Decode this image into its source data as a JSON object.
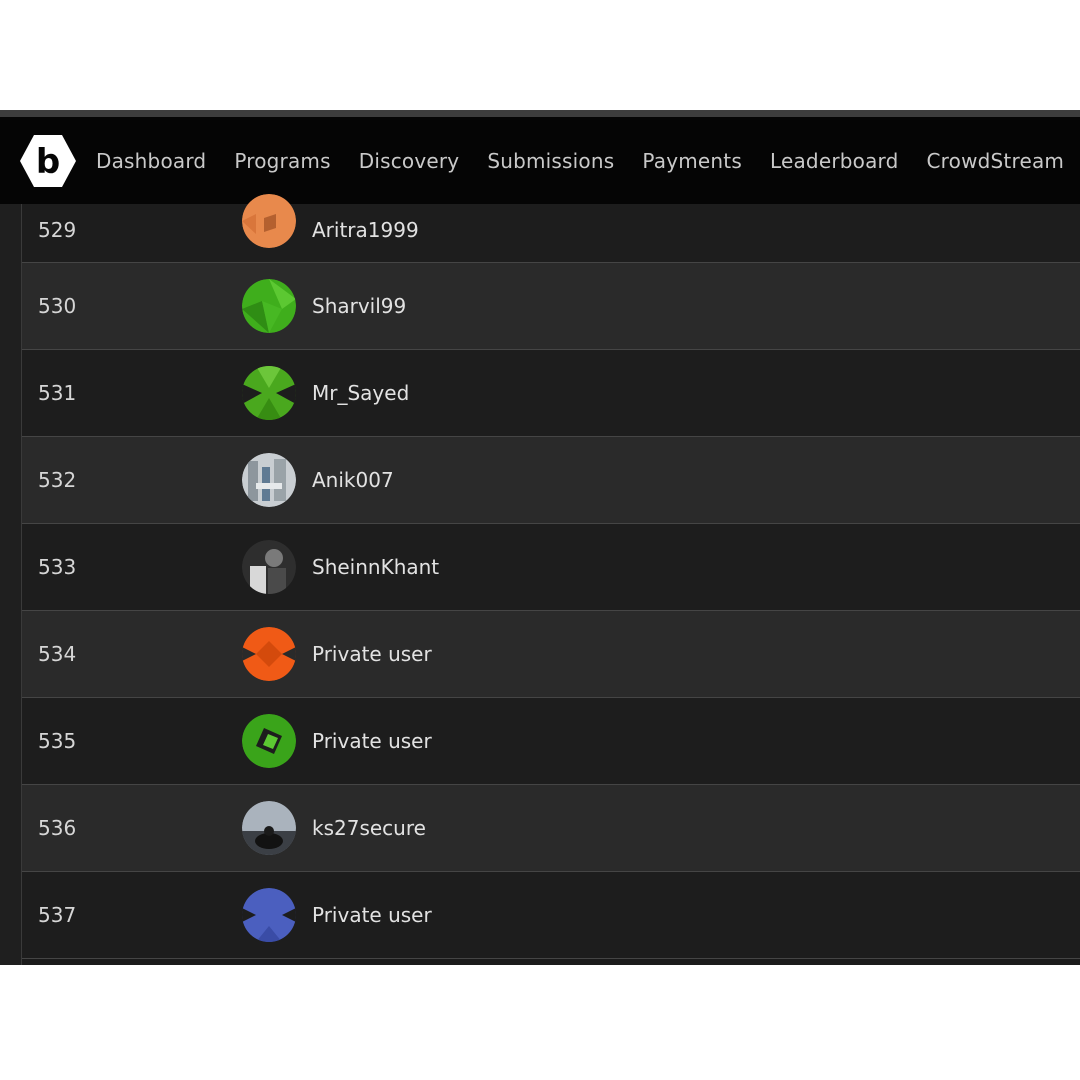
{
  "nav": {
    "items": [
      "Dashboard",
      "Programs",
      "Discovery",
      "Submissions",
      "Payments",
      "Leaderboard",
      "CrowdStream"
    ],
    "logo_letter": "b"
  },
  "leaderboard": {
    "rows": [
      {
        "rank": "529",
        "username": "Aritra1999",
        "avatar_icon": "orange-geometric-avatar",
        "avatar_color": "#e8894c"
      },
      {
        "rank": "530",
        "username": "Sharvil99",
        "avatar_icon": "green-geometric-avatar",
        "avatar_color": "#3fae1c"
      },
      {
        "rank": "531",
        "username": "Mr_Sayed",
        "avatar_icon": "green-geometric-avatar",
        "avatar_color": "#4aa81e"
      },
      {
        "rank": "532",
        "username": "Anik007",
        "avatar_icon": "photo-avatar",
        "avatar_color": "#9aa3a8"
      },
      {
        "rank": "533",
        "username": "SheinnKhant",
        "avatar_icon": "photo-avatar",
        "avatar_color": "#5a5a5a"
      },
      {
        "rank": "534",
        "username": "Private user",
        "avatar_icon": "orange-geometric-avatar",
        "avatar_color": "#f05a16"
      },
      {
        "rank": "535",
        "username": "Private user",
        "avatar_icon": "green-geometric-avatar",
        "avatar_color": "#3aa41a"
      },
      {
        "rank": "536",
        "username": "ks27secure",
        "avatar_icon": "photo-avatar",
        "avatar_color": "#6b7480"
      },
      {
        "rank": "537",
        "username": "Private user",
        "avatar_icon": "blue-geometric-avatar",
        "avatar_color": "#4b5fbf"
      }
    ]
  },
  "colors": {
    "navbar_bg": "#050505",
    "row_dark": "#1d1d1d",
    "row_light": "#2a2a2a",
    "text": "#e2e2e2"
  }
}
